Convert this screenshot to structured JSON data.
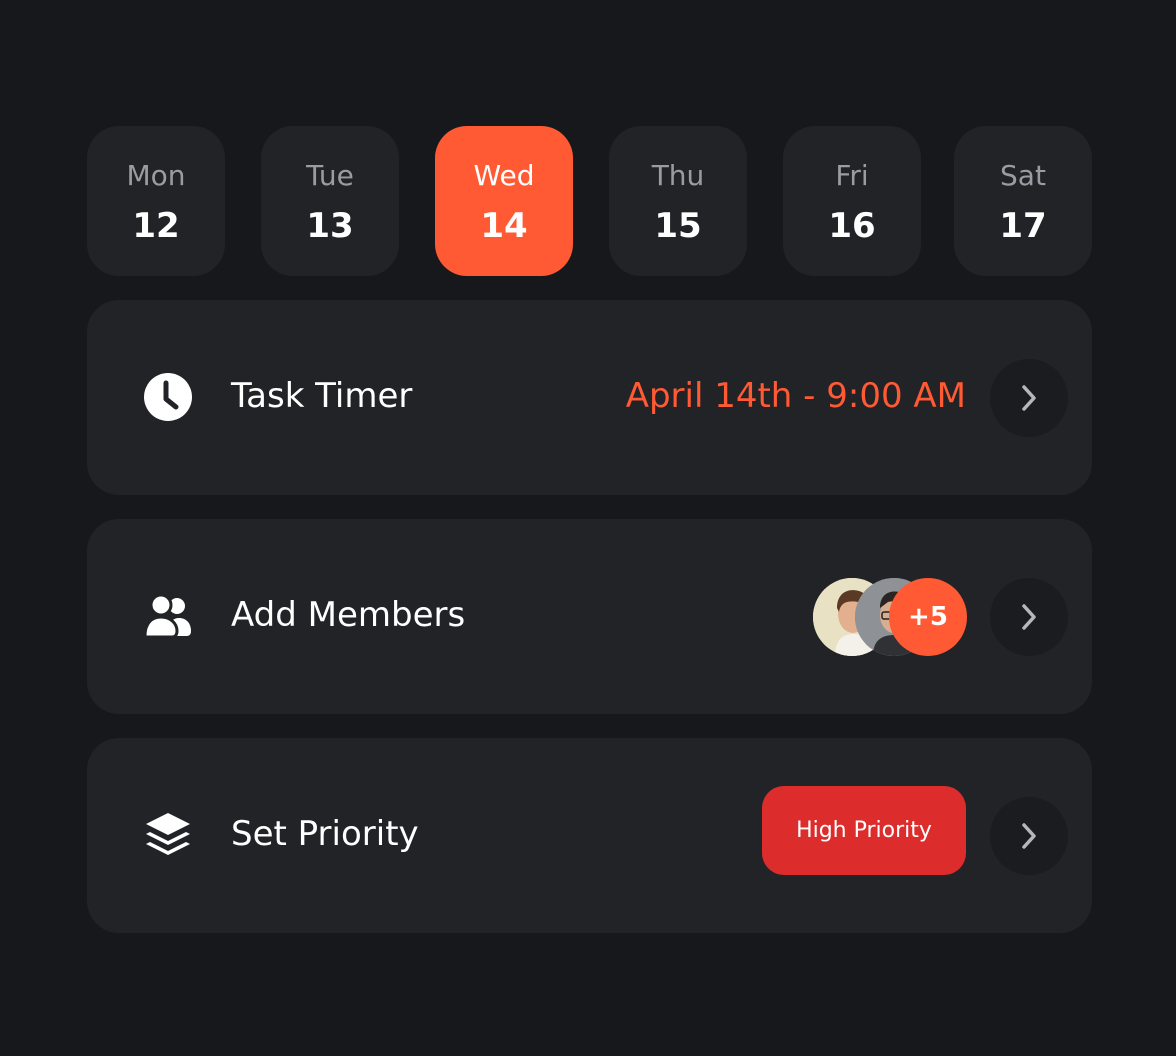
{
  "days": [
    {
      "name": "Mon",
      "num": "12"
    },
    {
      "name": "Tue",
      "num": "13"
    },
    {
      "name": "Wed",
      "num": "14"
    },
    {
      "name": "Thu",
      "num": "15"
    },
    {
      "name": "Fri",
      "num": "16"
    },
    {
      "name": "Sat",
      "num": "17"
    }
  ],
  "selected_day": "Wed",
  "task_timer": {
    "label": "Task Timer",
    "value": "April 14th - 9:00 AM",
    "icon": "clock-icon"
  },
  "members": {
    "label": "Add Members",
    "more_count": "+5",
    "icon": "users-icon"
  },
  "priority": {
    "label": "Set Priority",
    "badge": "High Priority",
    "icon": "layers-icon"
  },
  "colors": {
    "accent": "#ff5a33",
    "priority_high": "#dd2c2c",
    "card_bg": "#212327",
    "page_bg": "#17181c"
  }
}
